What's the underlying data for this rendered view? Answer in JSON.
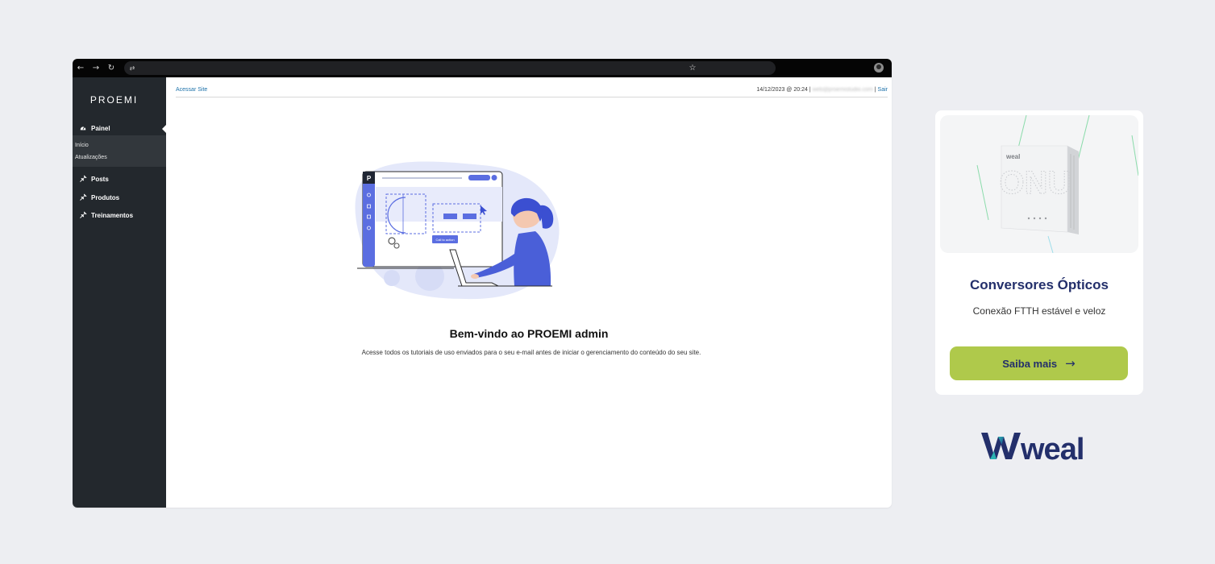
{
  "browser": {
    "back_icon": "←",
    "forward_icon": "→",
    "reload_icon": "↻",
    "tune_icon": "⇄",
    "star_icon": "☆"
  },
  "sidebar": {
    "logo": "PROEMI",
    "active_menu": {
      "label": "Painel",
      "icon": "dashboard-icon"
    },
    "submenu": [
      "Início",
      "Atualizações"
    ],
    "items": [
      {
        "label": "Posts",
        "icon": "pin-icon"
      },
      {
        "label": "Produtos",
        "icon": "pin-icon"
      },
      {
        "label": "Treinamentos",
        "icon": "pin-icon"
      }
    ]
  },
  "topbar": {
    "link": "Acessar Site",
    "datetime": "14/12/2023 @ 20:24",
    "separator": "|",
    "email": "web@proemistudio.com",
    "logout": "Sair"
  },
  "illustration": {
    "button_label": "Call to action",
    "logo_letter": "P"
  },
  "welcome": {
    "title": "Bem-vindo ao PROEMI admin",
    "text": "Acesse todos os tutoriais de uso enviados para o seu e-mail antes de iniciar o gerenciamento do conteúdo do seu site."
  },
  "ad": {
    "device_brand": "weal",
    "device_label": "ONU",
    "title": "Conversores Ópticos",
    "subtitle": "Conexão FTTH estável e veloz",
    "button": "Saiba mais",
    "button_arrow": "→",
    "logo": "weal",
    "colors": {
      "navy": "#232f6b",
      "green": "#afc94b",
      "teal": "#2bb3b1"
    }
  }
}
